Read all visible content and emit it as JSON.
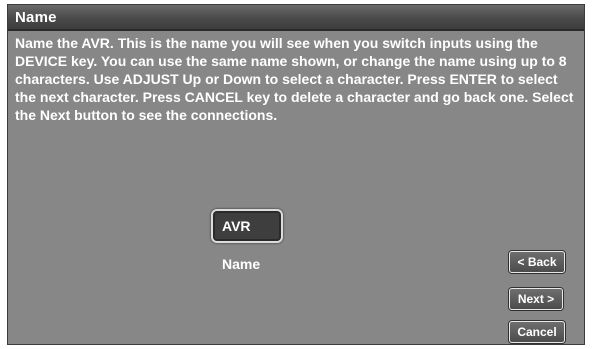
{
  "dialog": {
    "title": "Name",
    "instructions": "Name the AVR.  This is the name you will see when you switch inputs using the DEVICE key.  You can use the same name shown, or change the name using up to 8 characters. Use ADJUST Up or Down to select a character.  Press ENTER to select the next character.  Press CANCEL key to delete a character and go back one.  Select the Next button to see the connections."
  },
  "name_field": {
    "value": "AVR",
    "label": "Name"
  },
  "buttons": {
    "back": "< Back",
    "next": "Next >",
    "cancel": "Cancel"
  },
  "colors": {
    "panel": "#878787",
    "title_bar": "#4a4a4a",
    "text": "#ffffff",
    "field_bg": "#3e3e3e"
  }
}
